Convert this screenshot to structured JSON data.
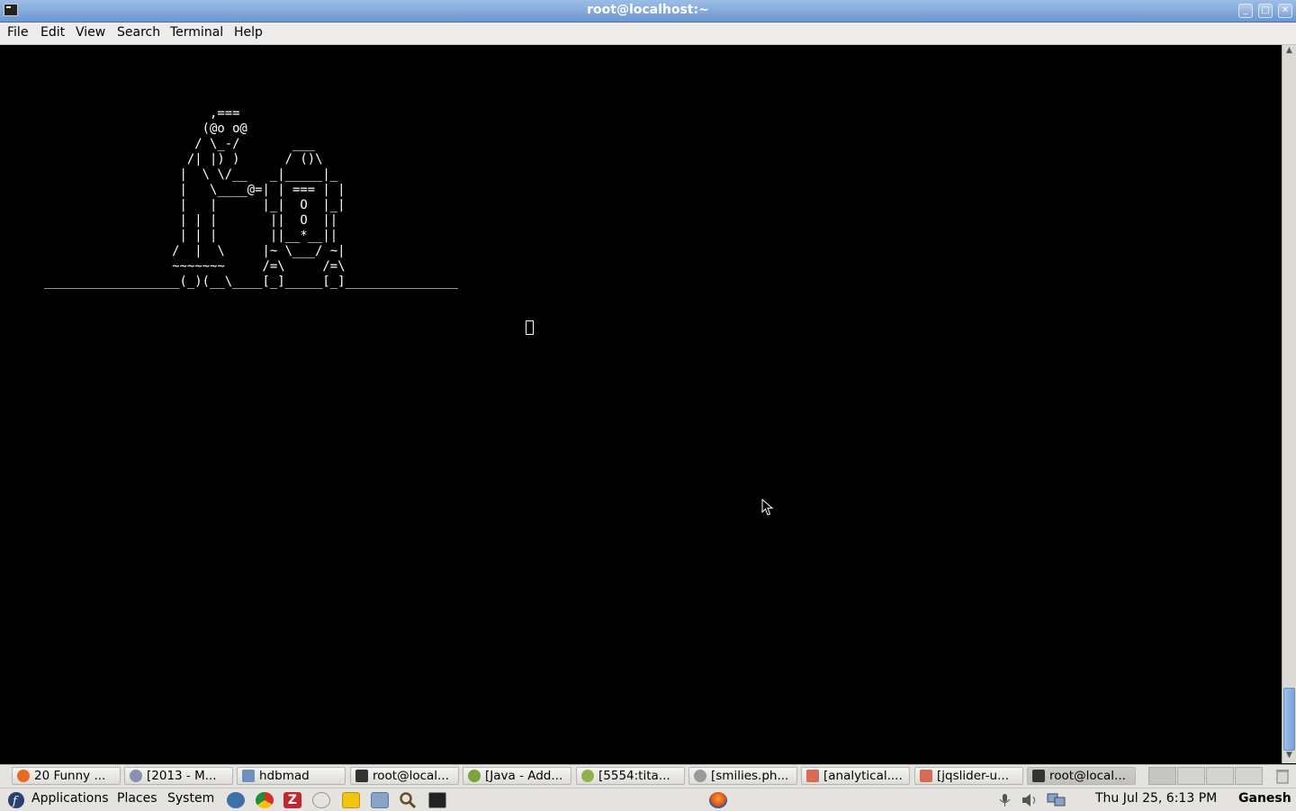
{
  "window": {
    "title": "root@localhost:~"
  },
  "menu": [
    "File",
    "Edit",
    "View",
    "Search",
    "Terminal",
    "Help"
  ],
  "terminal": {
    "ascii_art": "                      ,===\n                     (@o o@\n                    / \\_-/       ___\n                   /| |) )      / ()\\\n                  |  \\ \\/__   _|_____|_\n                  |   \\____@=| | === | |\n                  |   |      |_|  O  |_|\n                  | | |       ||  O  ||\n                  | | |       ||__*__||\n                 /  |  \\     |~ \\___/ ~|\n                 ~~~~~~~     /=\\     /=\\\n__________________(_)(__\\____[_]_____[_]_______________"
  },
  "taskbar": {
    "tasks": [
      {
        "label": "20 Funny ...",
        "icon": "firefox-icon",
        "color": "#e66a1f"
      },
      {
        "label": "[2013 - M...",
        "icon": "pidgin-icon",
        "color": "#8a8fb0"
      },
      {
        "label": "hdbmad",
        "icon": "folder-icon",
        "color": "#6e8fbf"
      },
      {
        "label": "root@local...",
        "icon": "terminal-icon",
        "color": "#333333"
      },
      {
        "label": "[Java - Add...",
        "icon": "eclipse-icon",
        "color": "#7aa33a"
      },
      {
        "label": "[5554:tita...",
        "icon": "android-icon",
        "color": "#8fb24c"
      },
      {
        "label": "[smilies.ph...",
        "icon": "editor-icon",
        "color": "#9a9a9a"
      },
      {
        "label": "[analytical....",
        "icon": "document-icon",
        "color": "#d86b55"
      },
      {
        "label": "[jqslider-u...",
        "icon": "document-icon",
        "color": "#d86b55"
      },
      {
        "label": "root@local...",
        "icon": "terminal-icon",
        "color": "#333333",
        "active": true
      }
    ]
  },
  "panel": {
    "menus": [
      "Applications",
      "Places",
      "System"
    ],
    "launchers": [
      "thunderbird-icon",
      "chrome-icon",
      "filezilla-icon",
      "email-icon",
      "notes-icon",
      "filemanager-icon",
      "search-icon",
      "terminal-icon"
    ],
    "center_icon": "firefox-icon",
    "tray": [
      "microphone-icon",
      "volume-icon",
      "network-icon"
    ],
    "clock": "Thu Jul 25,  6:13 PM",
    "user": "Ganesh"
  },
  "colors": {
    "titlebar": "#7ea5db",
    "terminal_bg": "#000000",
    "terminal_fg": "#ffffff",
    "panel": "#e4e3e0"
  }
}
